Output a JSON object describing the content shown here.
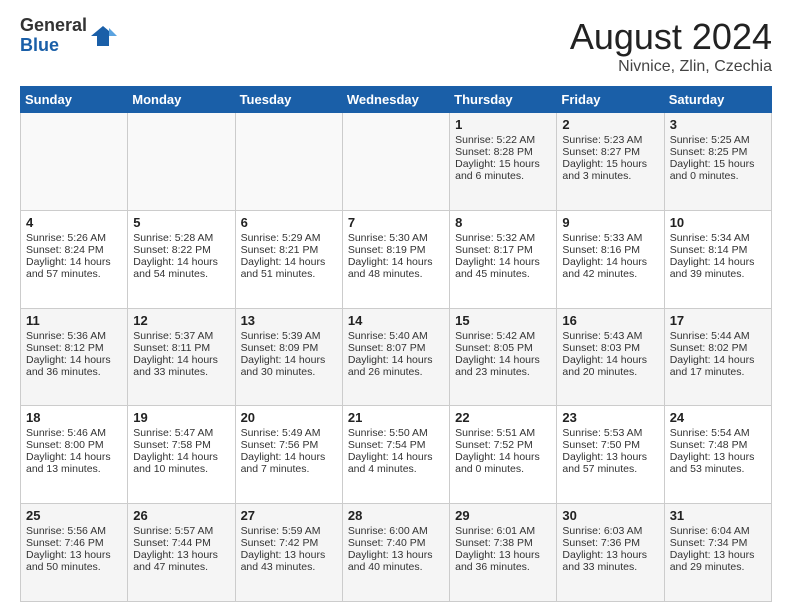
{
  "logo": {
    "general": "General",
    "blue": "Blue"
  },
  "header": {
    "month": "August 2024",
    "location": "Nivnice, Zlin, Czechia"
  },
  "weekdays": [
    "Sunday",
    "Monday",
    "Tuesday",
    "Wednesday",
    "Thursday",
    "Friday",
    "Saturday"
  ],
  "weeks": [
    [
      {
        "day": "",
        "lines": []
      },
      {
        "day": "",
        "lines": []
      },
      {
        "day": "",
        "lines": []
      },
      {
        "day": "",
        "lines": []
      },
      {
        "day": "1",
        "lines": [
          "Sunrise: 5:22 AM",
          "Sunset: 8:28 PM",
          "Daylight: 15 hours",
          "and 6 minutes."
        ]
      },
      {
        "day": "2",
        "lines": [
          "Sunrise: 5:23 AM",
          "Sunset: 8:27 PM",
          "Daylight: 15 hours",
          "and 3 minutes."
        ]
      },
      {
        "day": "3",
        "lines": [
          "Sunrise: 5:25 AM",
          "Sunset: 8:25 PM",
          "Daylight: 15 hours",
          "and 0 minutes."
        ]
      }
    ],
    [
      {
        "day": "4",
        "lines": [
          "Sunrise: 5:26 AM",
          "Sunset: 8:24 PM",
          "Daylight: 14 hours",
          "and 57 minutes."
        ]
      },
      {
        "day": "5",
        "lines": [
          "Sunrise: 5:28 AM",
          "Sunset: 8:22 PM",
          "Daylight: 14 hours",
          "and 54 minutes."
        ]
      },
      {
        "day": "6",
        "lines": [
          "Sunrise: 5:29 AM",
          "Sunset: 8:21 PM",
          "Daylight: 14 hours",
          "and 51 minutes."
        ]
      },
      {
        "day": "7",
        "lines": [
          "Sunrise: 5:30 AM",
          "Sunset: 8:19 PM",
          "Daylight: 14 hours",
          "and 48 minutes."
        ]
      },
      {
        "day": "8",
        "lines": [
          "Sunrise: 5:32 AM",
          "Sunset: 8:17 PM",
          "Daylight: 14 hours",
          "and 45 minutes."
        ]
      },
      {
        "day": "9",
        "lines": [
          "Sunrise: 5:33 AM",
          "Sunset: 8:16 PM",
          "Daylight: 14 hours",
          "and 42 minutes."
        ]
      },
      {
        "day": "10",
        "lines": [
          "Sunrise: 5:34 AM",
          "Sunset: 8:14 PM",
          "Daylight: 14 hours",
          "and 39 minutes."
        ]
      }
    ],
    [
      {
        "day": "11",
        "lines": [
          "Sunrise: 5:36 AM",
          "Sunset: 8:12 PM",
          "Daylight: 14 hours",
          "and 36 minutes."
        ]
      },
      {
        "day": "12",
        "lines": [
          "Sunrise: 5:37 AM",
          "Sunset: 8:11 PM",
          "Daylight: 14 hours",
          "and 33 minutes."
        ]
      },
      {
        "day": "13",
        "lines": [
          "Sunrise: 5:39 AM",
          "Sunset: 8:09 PM",
          "Daylight: 14 hours",
          "and 30 minutes."
        ]
      },
      {
        "day": "14",
        "lines": [
          "Sunrise: 5:40 AM",
          "Sunset: 8:07 PM",
          "Daylight: 14 hours",
          "and 26 minutes."
        ]
      },
      {
        "day": "15",
        "lines": [
          "Sunrise: 5:42 AM",
          "Sunset: 8:05 PM",
          "Daylight: 14 hours",
          "and 23 minutes."
        ]
      },
      {
        "day": "16",
        "lines": [
          "Sunrise: 5:43 AM",
          "Sunset: 8:03 PM",
          "Daylight: 14 hours",
          "and 20 minutes."
        ]
      },
      {
        "day": "17",
        "lines": [
          "Sunrise: 5:44 AM",
          "Sunset: 8:02 PM",
          "Daylight: 14 hours",
          "and 17 minutes."
        ]
      }
    ],
    [
      {
        "day": "18",
        "lines": [
          "Sunrise: 5:46 AM",
          "Sunset: 8:00 PM",
          "Daylight: 14 hours",
          "and 13 minutes."
        ]
      },
      {
        "day": "19",
        "lines": [
          "Sunrise: 5:47 AM",
          "Sunset: 7:58 PM",
          "Daylight: 14 hours",
          "and 10 minutes."
        ]
      },
      {
        "day": "20",
        "lines": [
          "Sunrise: 5:49 AM",
          "Sunset: 7:56 PM",
          "Daylight: 14 hours",
          "and 7 minutes."
        ]
      },
      {
        "day": "21",
        "lines": [
          "Sunrise: 5:50 AM",
          "Sunset: 7:54 PM",
          "Daylight: 14 hours",
          "and 4 minutes."
        ]
      },
      {
        "day": "22",
        "lines": [
          "Sunrise: 5:51 AM",
          "Sunset: 7:52 PM",
          "Daylight: 14 hours",
          "and 0 minutes."
        ]
      },
      {
        "day": "23",
        "lines": [
          "Sunrise: 5:53 AM",
          "Sunset: 7:50 PM",
          "Daylight: 13 hours",
          "and 57 minutes."
        ]
      },
      {
        "day": "24",
        "lines": [
          "Sunrise: 5:54 AM",
          "Sunset: 7:48 PM",
          "Daylight: 13 hours",
          "and 53 minutes."
        ]
      }
    ],
    [
      {
        "day": "25",
        "lines": [
          "Sunrise: 5:56 AM",
          "Sunset: 7:46 PM",
          "Daylight: 13 hours",
          "and 50 minutes."
        ]
      },
      {
        "day": "26",
        "lines": [
          "Sunrise: 5:57 AM",
          "Sunset: 7:44 PM",
          "Daylight: 13 hours",
          "and 47 minutes."
        ]
      },
      {
        "day": "27",
        "lines": [
          "Sunrise: 5:59 AM",
          "Sunset: 7:42 PM",
          "Daylight: 13 hours",
          "and 43 minutes."
        ]
      },
      {
        "day": "28",
        "lines": [
          "Sunrise: 6:00 AM",
          "Sunset: 7:40 PM",
          "Daylight: 13 hours",
          "and 40 minutes."
        ]
      },
      {
        "day": "29",
        "lines": [
          "Sunrise: 6:01 AM",
          "Sunset: 7:38 PM",
          "Daylight: 13 hours",
          "and 36 minutes."
        ]
      },
      {
        "day": "30",
        "lines": [
          "Sunrise: 6:03 AM",
          "Sunset: 7:36 PM",
          "Daylight: 13 hours",
          "and 33 minutes."
        ]
      },
      {
        "day": "31",
        "lines": [
          "Sunrise: 6:04 AM",
          "Sunset: 7:34 PM",
          "Daylight: 13 hours",
          "and 29 minutes."
        ]
      }
    ]
  ]
}
